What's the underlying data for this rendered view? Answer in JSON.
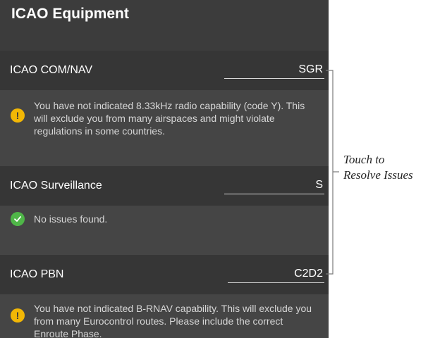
{
  "header": {
    "title": "ICAO Equipment"
  },
  "fields": [
    {
      "label": "ICAO COM/NAV",
      "value": "SGR",
      "status": "warning",
      "message": "You have not indicated 8.33kHz radio capability (code Y). This will exclude you from many airspaces and might violate regulations in some countries.",
      "icon": "exclamation-icon"
    },
    {
      "label": "ICAO Surveillance",
      "value": "S",
      "status": "ok",
      "message": "No issues found.",
      "icon": "check-icon"
    },
    {
      "label": "ICAO PBN",
      "value": "C2D2",
      "status": "warning",
      "message": "You have not indicated B-RNAV capability. This will exclude you from many Eurocontrol routes. Please include the correct Enroute Phase.",
      "icon": "exclamation-icon"
    }
  ],
  "callout": {
    "line1": "Touch to",
    "line2": "Resolve Issues"
  },
  "colors": {
    "warning": "#f2b705",
    "ok": "#4fb648",
    "row_background": "#363636",
    "panel_background": "#454545"
  }
}
